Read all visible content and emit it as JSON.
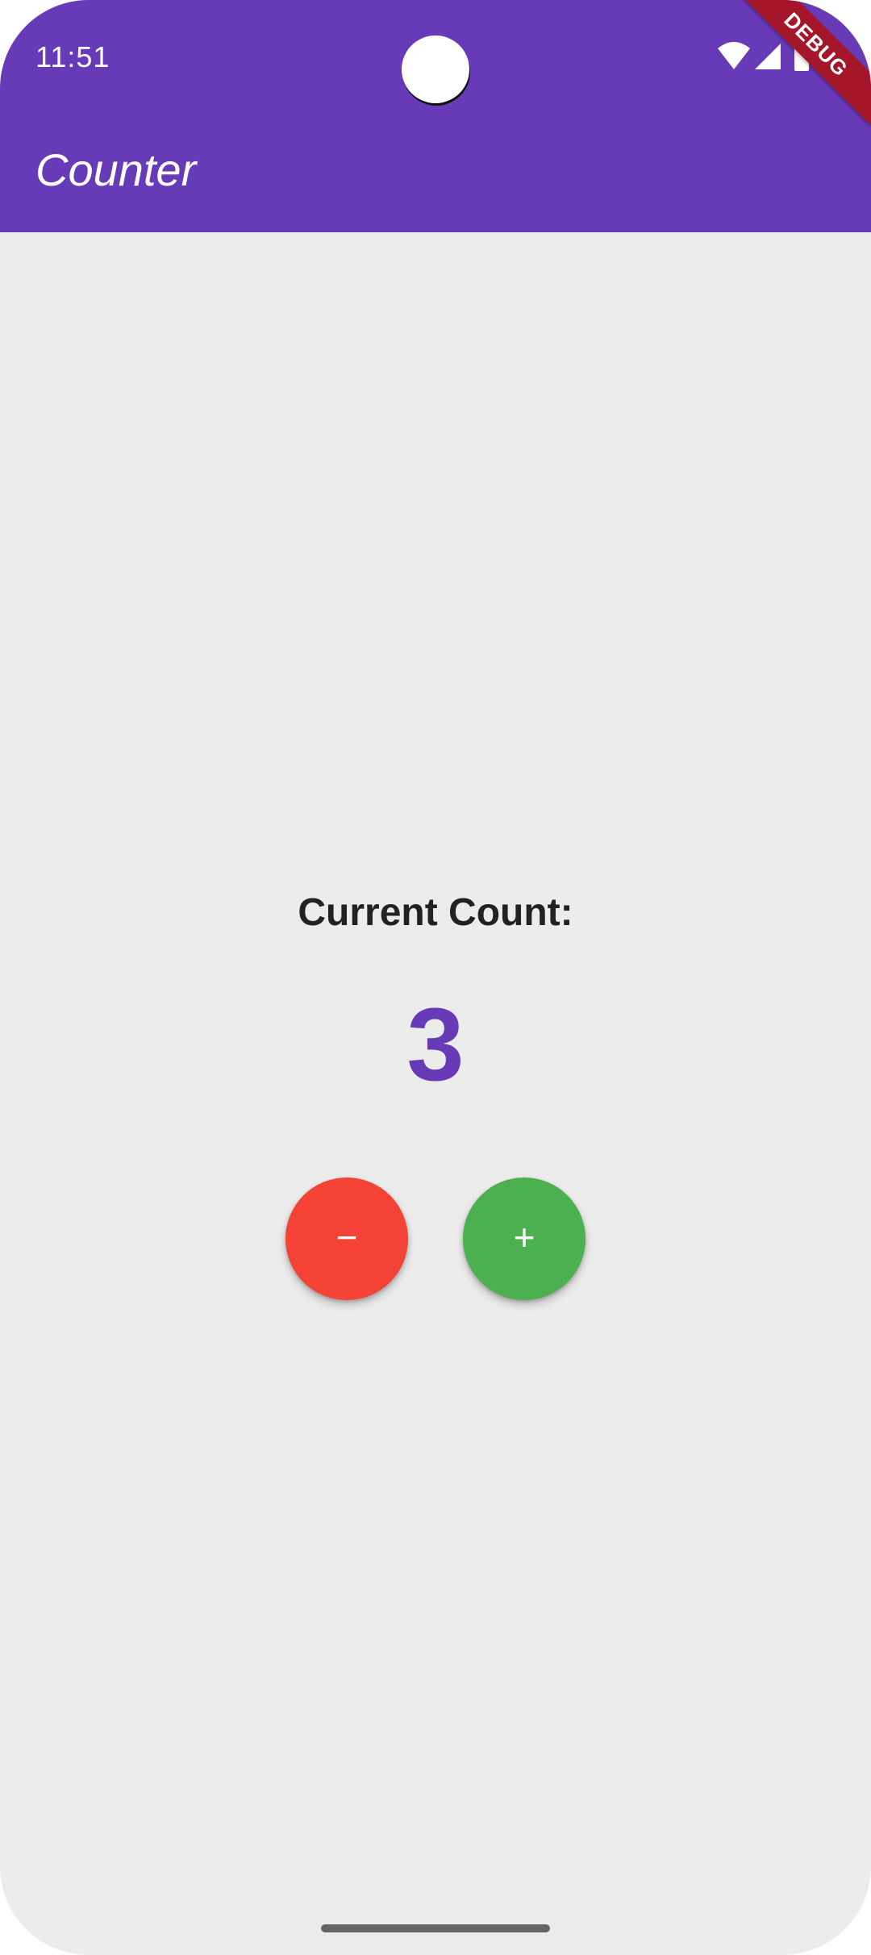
{
  "status_bar": {
    "time": "11:51",
    "icons": [
      "wifi-icon",
      "signal-icon",
      "battery-icon"
    ]
  },
  "debug_banner": "DEBUG",
  "app_bar": {
    "title": "Counter"
  },
  "counter": {
    "label": "Current Count:",
    "value": "3"
  },
  "actions": {
    "decrement_label": "−",
    "increment_label": "+"
  },
  "colors": {
    "primary": "#673ab7",
    "background": "#ececec",
    "decrement": "#f44336",
    "increment": "#4caf50",
    "debug": "#a6162b"
  }
}
